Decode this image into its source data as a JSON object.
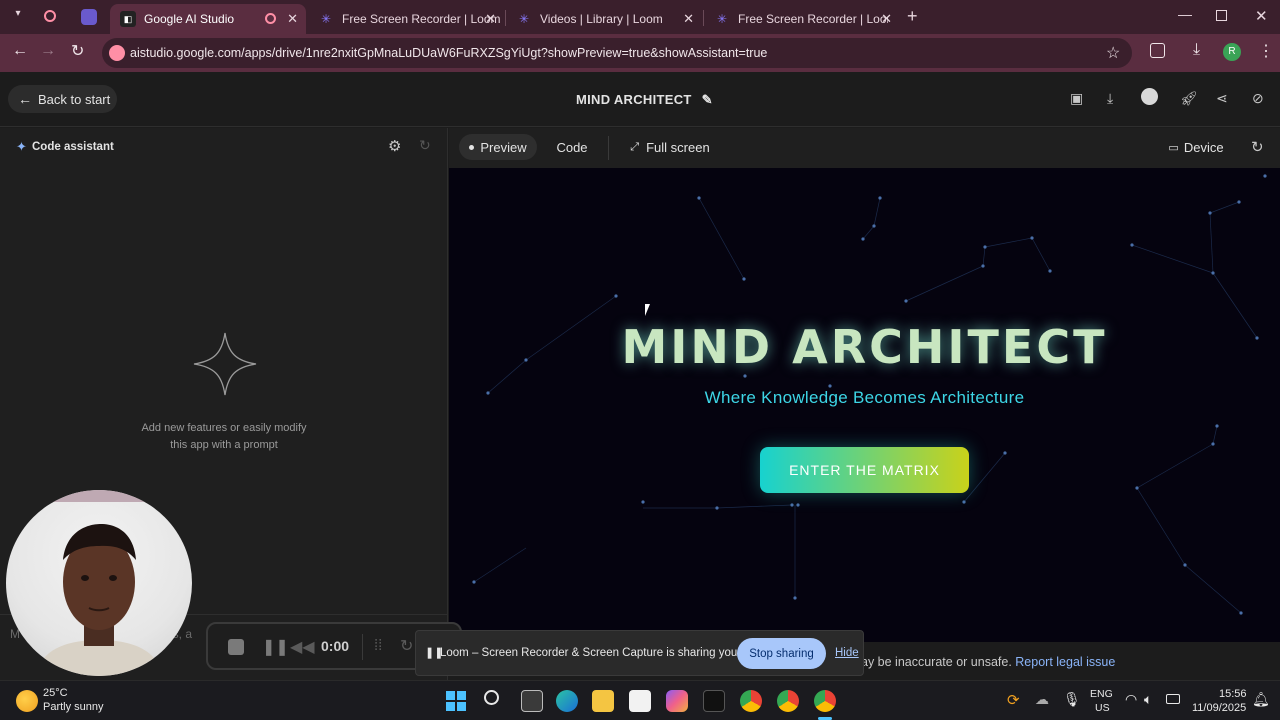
{
  "browser": {
    "tabs": [
      {
        "title": "Google AI Studio",
        "active": true
      },
      {
        "title": "Free Screen Recorder | Loom",
        "active": false
      },
      {
        "title": "Videos | Library | Loom",
        "active": false
      },
      {
        "title": "Free Screen Recorder | Loom - T",
        "active": false
      }
    ],
    "url": "aistudio.google.com/apps/drive/1nre2nxitGpMnaLuDUaW6FuRXZSgYiUgt?showPreview=true&showAssistant=true",
    "profile_initial": "R"
  },
  "header": {
    "back_label": "Back to start",
    "app_title": "MIND ARCHITECT"
  },
  "assistant": {
    "label": "Code assistant",
    "empty_line1": "Add new features or easily modify",
    "empty_line2": "this app with a prompt",
    "input_placeholder_fragment": "M",
    "input_placeholder_tail": "res, a"
  },
  "preview_tabs": {
    "preview": "Preview",
    "code": "Code",
    "fullscreen": "Full screen",
    "device": "Device"
  },
  "app": {
    "title": "MIND ARCHITECT",
    "subtitle": "Where Knowledge Becomes Architecture",
    "cta": "ENTER THE MATRIX"
  },
  "footer": {
    "disclaimer": "ay be inaccurate or unsafe.",
    "report_link": "Report legal issue"
  },
  "loom": {
    "sharing_text": "Loom – Screen Recorder & Screen Capture is sharing your screen.",
    "stop_sharing": "Stop sharing",
    "hide": "Hide",
    "timer": "0:00"
  },
  "taskbar": {
    "weather_temp": "25°C",
    "weather_desc": "Partly sunny",
    "lang_top": "ENG",
    "lang_bottom": "US",
    "time": "15:56",
    "date": "11/09/2025"
  }
}
